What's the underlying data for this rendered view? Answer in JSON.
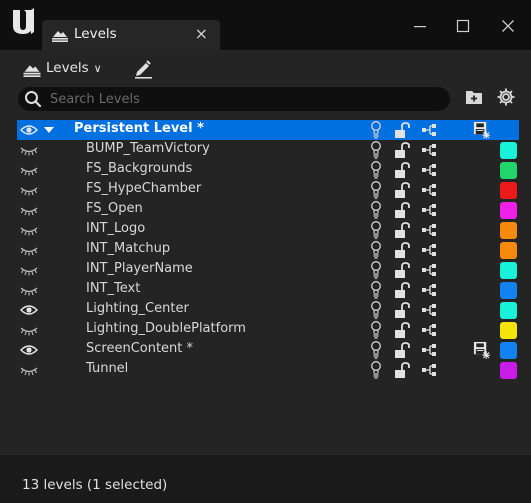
{
  "window": {
    "tab_title": "Levels",
    "tab_close_glyph": "×",
    "minimize_glyph": "—",
    "maximize_glyph": "☐",
    "close_glyph": "✕"
  },
  "toolbar": {
    "levels_menu_label": "Levels",
    "levels_menu_chevron": "∨"
  },
  "search": {
    "placeholder": "Search Levels",
    "value": ""
  },
  "levels": [
    {
      "name": "Persistent Level *",
      "visible": true,
      "persistent": true,
      "selected": true,
      "unsaved": true,
      "color": null
    },
    {
      "name": "BUMP_TeamVictory",
      "visible": false,
      "color": "#19f2d8"
    },
    {
      "name": "FS_Backgrounds",
      "visible": false,
      "color": "#21d46b"
    },
    {
      "name": "FS_HypeChamber",
      "visible": false,
      "color": "#ee1a1a"
    },
    {
      "name": "FS_Open",
      "visible": false,
      "color": "#ee1fe6"
    },
    {
      "name": "INT_Logo",
      "visible": false,
      "color": "#f58a0c"
    },
    {
      "name": "INT_Matchup",
      "visible": false,
      "color": "#f58a0c"
    },
    {
      "name": "INT_PlayerName",
      "visible": false,
      "color": "#19f2d8"
    },
    {
      "name": "INT_Text",
      "visible": false,
      "color": "#1182f0"
    },
    {
      "name": "Lighting_Center",
      "visible": true,
      "color": "#19f2d8"
    },
    {
      "name": "Lighting_DoublePlatform",
      "visible": false,
      "color": "#f5e30c"
    },
    {
      "name": "ScreenContent *",
      "visible": true,
      "unsaved": true,
      "color": "#1182f0"
    },
    {
      "name": "Tunnel",
      "visible": false,
      "color": "#c81de8"
    }
  ],
  "status": {
    "text": "13 levels (1 selected)"
  },
  "icons": {
    "app_logo": "unreal-logo-icon",
    "levels": "levels-icon",
    "edit": "edit-pencil-icon",
    "search": "search-icon",
    "add_folder": "add-folder-icon",
    "settings": "gear-icon",
    "visible": "eye-open-icon",
    "hidden": "eye-closed-icon",
    "lighting": "light-bulb-icon",
    "lock": "unlock-icon",
    "hierarchy": "hierarchy-icon",
    "save": "save-icon"
  }
}
